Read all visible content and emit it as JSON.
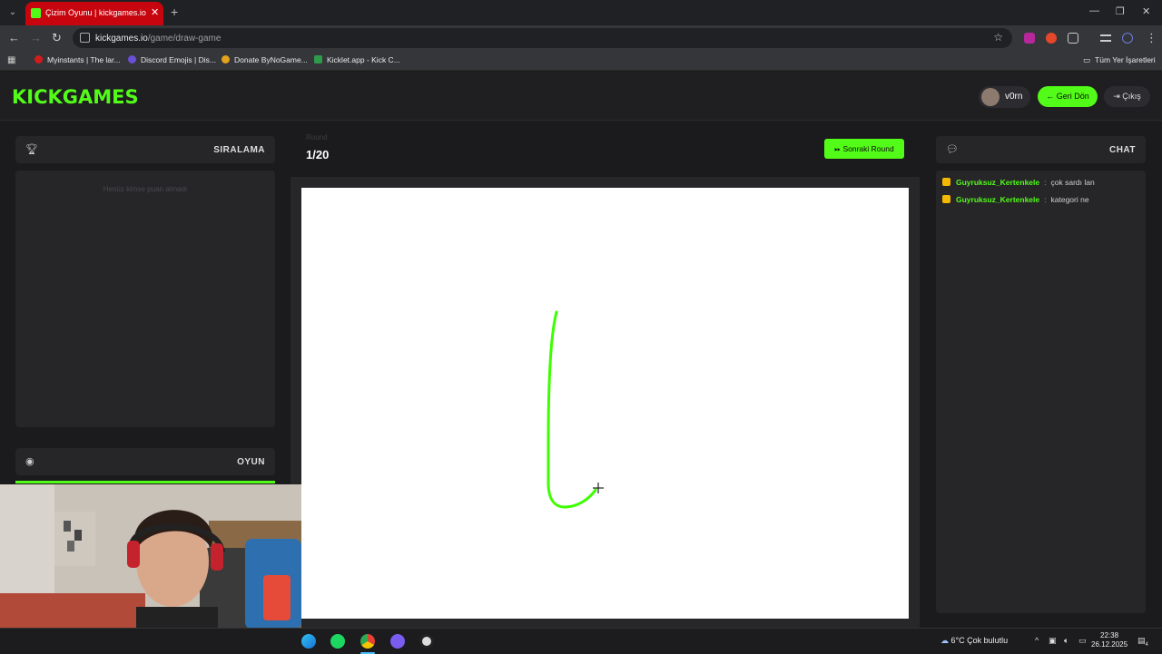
{
  "browser": {
    "tab_title": "Çizim Oyunu | kickgames.io",
    "url_domain": "kickgames.io",
    "url_path": "/game/draw-game",
    "bookmarks": [
      "Myinstants | The lar...",
      "Discord Emojis | Dis...",
      "Donate ByNoGame...",
      "Kicklet.app - Kick C..."
    ],
    "all_bookmarks": "Tüm Yer İşaretleri"
  },
  "header": {
    "logo": "KICKGAMES",
    "username": "v0rn",
    "back_label": "Geri Dön",
    "exit_label": "Çıkış"
  },
  "ranking": {
    "title": "SIRALAMA",
    "empty_text": "Henüz kimse puan almadı"
  },
  "game": {
    "title": "OYUN"
  },
  "round": {
    "label": "Round",
    "count": "1/20",
    "next_label": "Sonraki Round"
  },
  "chat": {
    "title": "CHAT",
    "messages": [
      {
        "user": "Guyruksuz_Kertenkele",
        "text": "çok sardı lan"
      },
      {
        "user": "Guyruksuz_Kertenkele",
        "text": "kategori ne"
      }
    ]
  },
  "taskbar": {
    "weather": "6°C  Çok bulutlu",
    "time": "22:38",
    "date": "26.12.2025",
    "notifications": "4"
  },
  "colors": {
    "accent": "#53fc18",
    "stroke": "#3cff00",
    "tab_red": "#c7050f",
    "panel": "#262629"
  }
}
